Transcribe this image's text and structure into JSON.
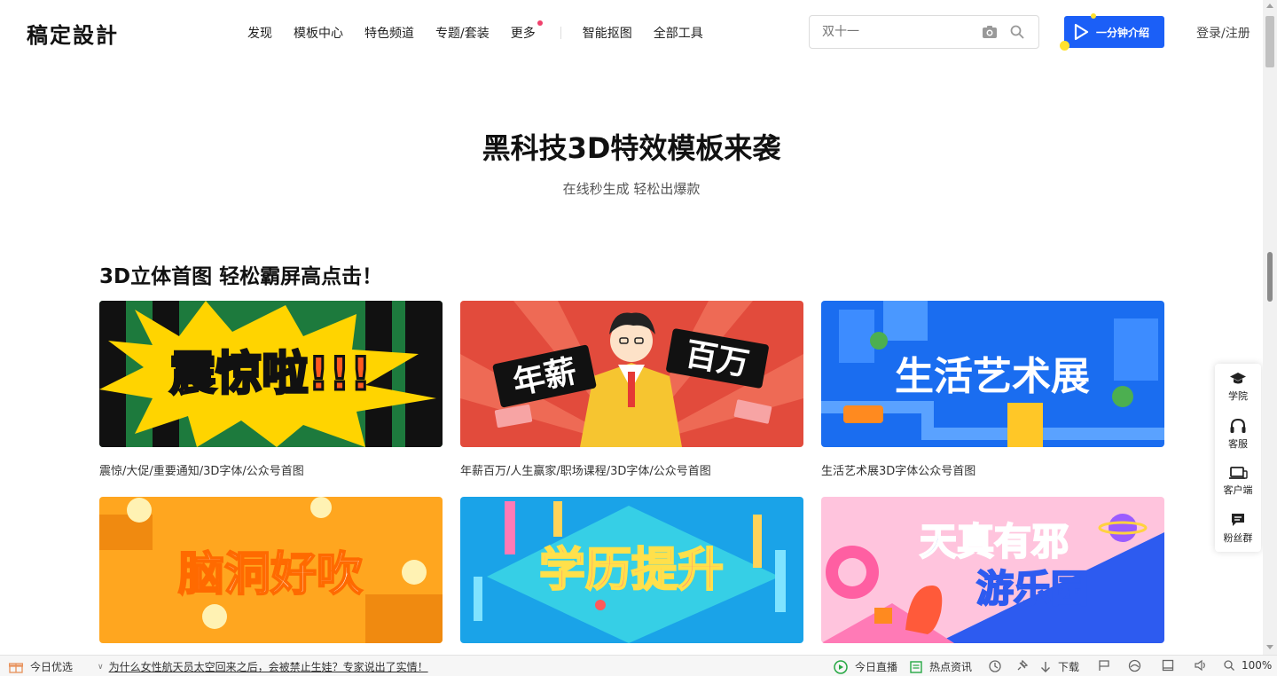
{
  "header": {
    "logo": "稿定設計",
    "nav": [
      {
        "label": "发现",
        "dot": false
      },
      {
        "label": "模板中心",
        "dot": false
      },
      {
        "label": "特色频道",
        "dot": false
      },
      {
        "label": "专题/套装",
        "dot": false
      },
      {
        "label": "更多",
        "dot": true
      }
    ],
    "nav_right": [
      "智能抠图",
      "全部工具"
    ],
    "search_placeholder": "双十一",
    "intro_button": "一分钟介绍",
    "login": "登录/注册"
  },
  "hero": {
    "title": "黑科技3D特效模板来袭",
    "subtitle": "在线秒生成 轻松出爆款"
  },
  "section": {
    "title": "3D立体首图 轻松霸屏高点击！",
    "cards": [
      {
        "caption": "震惊/大促/重要通知/3D字体/公众号首图",
        "art_text": "震惊啦!!!"
      },
      {
        "caption": "年薪百万/人生赢家/职场课程/3D字体/公众号首图",
        "art_text_left": "年薪",
        "art_text_right": "百万"
      },
      {
        "caption": "生活艺术展3D字体公众号首图",
        "art_text": "生活艺术展"
      },
      {
        "caption": "",
        "art_text": "脑洞好吹"
      },
      {
        "caption": "",
        "art_text": "学历提升"
      },
      {
        "caption": "",
        "art_text_top": "天真有邪",
        "art_text_bottom": "游乐园"
      }
    ]
  },
  "side_float": [
    {
      "label": "学院",
      "icon": "graduation-cap-icon"
    },
    {
      "label": "客服",
      "icon": "headphones-icon"
    },
    {
      "label": "客户端",
      "icon": "laptop-icon"
    },
    {
      "label": "粉丝群",
      "icon": "chat-icon"
    }
  ],
  "status_bar": {
    "left_label": "今日优选",
    "headline": "为什么女性航天员太空回来之后，会被禁止生娃？专家说出了实情！",
    "live": "今日直播",
    "news": "热点资讯",
    "download": "下载",
    "zoom": "100%"
  },
  "colors": {
    "brand_blue": "#1b5ff7",
    "accent_yellow": "#ffe12e",
    "dot_red": "#f0416c"
  }
}
